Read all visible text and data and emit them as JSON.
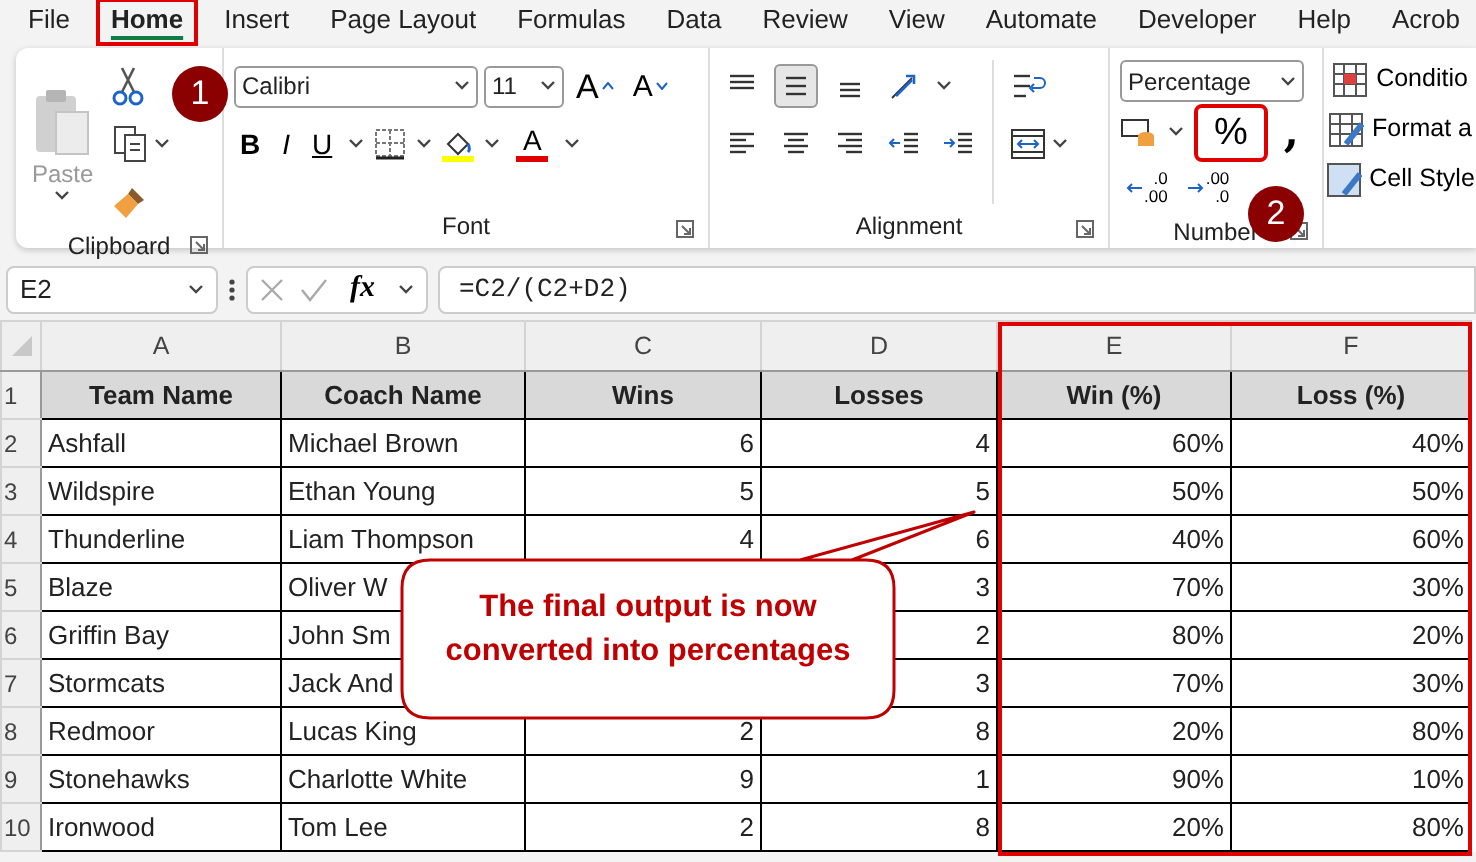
{
  "menu_tabs": [
    {
      "label": "File",
      "selected": false,
      "highlighted": false
    },
    {
      "label": "Home",
      "selected": true,
      "highlighted": true
    },
    {
      "label": "Insert",
      "selected": false,
      "highlighted": false
    },
    {
      "label": "Page Layout",
      "selected": false,
      "highlighted": false
    },
    {
      "label": "Formulas",
      "selected": false,
      "highlighted": false
    },
    {
      "label": "Data",
      "selected": false,
      "highlighted": false
    },
    {
      "label": "Review",
      "selected": false,
      "highlighted": false
    },
    {
      "label": "View",
      "selected": false,
      "highlighted": false
    },
    {
      "label": "Automate",
      "selected": false,
      "highlighted": false
    },
    {
      "label": "Developer",
      "selected": false,
      "highlighted": false
    },
    {
      "label": "Help",
      "selected": false,
      "highlighted": false
    },
    {
      "label": "Acrob",
      "selected": false,
      "highlighted": false
    }
  ],
  "ribbon": {
    "clipboard": {
      "paste_label": "Paste",
      "paste_disabled": true,
      "label": "Clipboard"
    },
    "font": {
      "font_name": "Calibri",
      "font_size": "11",
      "grow_label": "A",
      "shrink_label": "A",
      "bold_label": "B",
      "italic_label": "I",
      "underline_label": "U",
      "font_color_label": "A",
      "label": "Font"
    },
    "alignment": {
      "label": "Alignment",
      "row_1": [
        {
          "kind": "top",
          "selected": false
        },
        {
          "kind": "middle",
          "selected": true
        },
        {
          "kind": "bottom",
          "selected": false
        },
        {
          "kind": "orientation",
          "selected": false
        }
      ],
      "row_2": [
        {
          "kind": "left",
          "selected": false
        },
        {
          "kind": "center",
          "selected": false
        },
        {
          "kind": "right",
          "selected": false
        },
        {
          "kind": "outdent",
          "selected": false
        },
        {
          "kind": "indent",
          "selected": false
        }
      ]
    },
    "number": {
      "format": "Percentage",
      "percent_label": "%",
      "percent_highlighted": true,
      "comma_label": ",",
      "decimals": [
        {
          "kind": "increase",
          "top": ".0",
          "bottom": ".00"
        },
        {
          "kind": "decrease",
          "top": ".00",
          "bottom": ".0"
        }
      ],
      "label": "Number"
    },
    "styles": [
      {
        "kind": "conditional",
        "label": "Conditio"
      },
      {
        "kind": "table",
        "label": "Format a"
      },
      {
        "kind": "cell",
        "label": "Cell Style"
      }
    ]
  },
  "step_markers": [
    "1",
    "2"
  ],
  "formula_bar": {
    "name_box": "E2",
    "fx": "fx",
    "formula": "=C2/(C2+D2)"
  },
  "sheet": {
    "columns": [
      {
        "letter": "A",
        "highlighted": false
      },
      {
        "letter": "B",
        "highlighted": false
      },
      {
        "letter": "C",
        "highlighted": false
      },
      {
        "letter": "D",
        "highlighted": false
      },
      {
        "letter": "E",
        "highlighted": true
      },
      {
        "letter": "F",
        "highlighted": true
      }
    ],
    "rows": [
      {
        "number": "1",
        "kind": "header",
        "cells": [
          "Team Name",
          "Coach Name",
          "Wins",
          "Losses",
          "Win (%)",
          "Loss (%)"
        ]
      },
      {
        "number": "2",
        "kind": "data",
        "cells": [
          "Ashfall",
          "Michael Brown",
          "6",
          "4",
          "60%",
          "40%"
        ]
      },
      {
        "number": "3",
        "kind": "data",
        "cells": [
          "Wildspire",
          "Ethan Young",
          "5",
          "5",
          "50%",
          "50%"
        ]
      },
      {
        "number": "4",
        "kind": "data",
        "cells": [
          "Thunderline",
          "Liam Thompson",
          "4",
          "6",
          "40%",
          "60%"
        ]
      },
      {
        "number": "5",
        "kind": "data",
        "cells": [
          "Blaze",
          "Oliver W",
          null,
          "3",
          "70%",
          "30%"
        ]
      },
      {
        "number": "6",
        "kind": "data",
        "cells": [
          "Griffin Bay",
          "John Sm",
          null,
          "2",
          "80%",
          "20%"
        ]
      },
      {
        "number": "7",
        "kind": "data",
        "cells": [
          "Stormcats",
          "Jack And",
          null,
          "3",
          "70%",
          "30%"
        ]
      },
      {
        "number": "8",
        "kind": "data",
        "cells": [
          "Redmoor",
          "Lucas King",
          "2",
          "8",
          "20%",
          "80%"
        ]
      },
      {
        "number": "9",
        "kind": "data",
        "cells": [
          "Stonehawks",
          "Charlotte White",
          "9",
          "1",
          "90%",
          "10%"
        ]
      },
      {
        "number": "10",
        "kind": "data",
        "cells": [
          "Ironwood",
          "Tom Lee",
          "2",
          "8",
          "20%",
          "80%"
        ]
      }
    ]
  },
  "callout": {
    "text": "The final output is now converted into percentages"
  }
}
